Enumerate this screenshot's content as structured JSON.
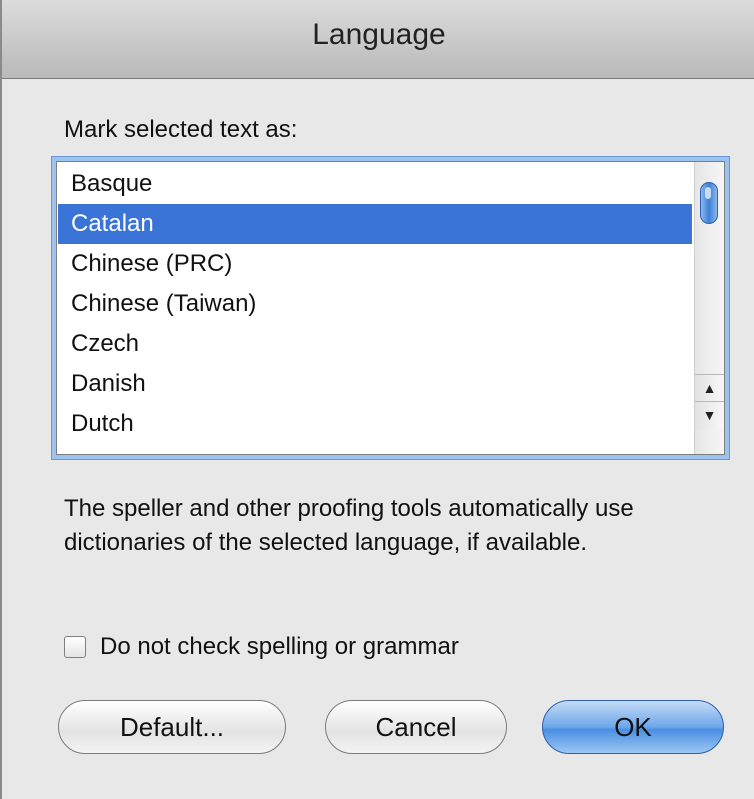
{
  "window": {
    "title": "Language"
  },
  "prompt": "Mark selected text as:",
  "languages": {
    "items": [
      "Basque",
      "Catalan",
      "Chinese (PRC)",
      "Chinese (Taiwan)",
      "Czech",
      "Danish",
      "Dutch"
    ],
    "selected": "Catalan"
  },
  "description": "The speller and other proofing tools automatically use dictionaries of the selected language, if available.",
  "checkbox": {
    "label": "Do not check spelling or grammar",
    "checked": false
  },
  "buttons": {
    "default": "Default...",
    "cancel": "Cancel",
    "ok": "OK"
  },
  "scrollbar": {
    "up_arrow": "▲",
    "down_arrow": "▼"
  },
  "colors": {
    "selection": "#3a74d6",
    "focus_ring": "#9cc2ee",
    "ok_button": "#4a8ee3"
  }
}
